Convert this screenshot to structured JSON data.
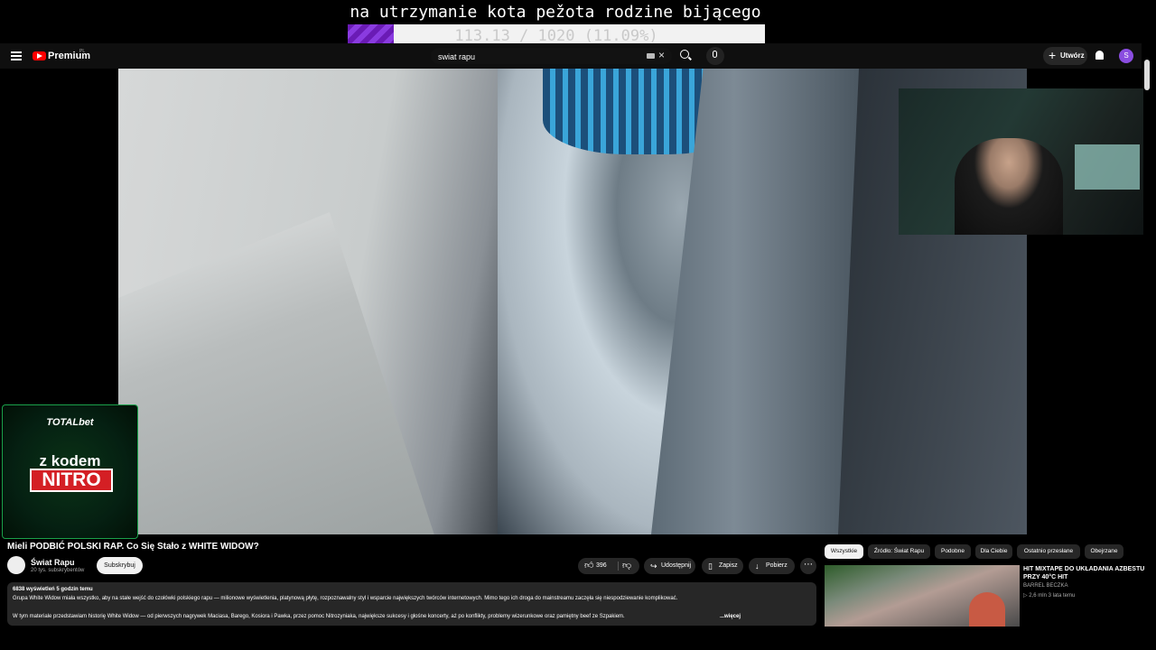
{
  "overlay": {
    "goal_title": "na utrzymanie kota pežota rodzine bijącego",
    "goal_text": "113.13 / 1020 (11.09%)",
    "goal_fraction": 0.1109,
    "accent": "#7a2bd0"
  },
  "topbar": {
    "brand": "Premium",
    "region": "PL",
    "search_value": "swiat rapu",
    "create_label": "Utwórz",
    "avatar_letter": "S"
  },
  "sponsor": {
    "logo": "TOTALbet",
    "code_text": "z kodem",
    "code": "NITRO"
  },
  "video": {
    "title": "Mieli PODBIĆ POLSKI RAP. Co Się Stało z WHITE WIDOW?",
    "channel": "Świat Rapu",
    "subscribers": "20 tys. subskrybentów",
    "subscribe_label": "Subskrybuj",
    "likes": "396",
    "share_label": "Udostępnij",
    "save_label": "Zapisz",
    "download_label": "Pobierz"
  },
  "description": {
    "stats": "6838 wyświetleń  5 godzin temu",
    "line1": "Grupa White Widow miała wszystko, aby na stałe wejść do czołówki polskiego rapu — milionowe wyświetlenia, platynową płytę, rozpoznawalny styl i wsparcie największych twórców internetowych. Mimo tego ich droga do mainstreamu zaczęła się niespodziewanie komplikować.",
    "line2": "W tym materiale przedstawiam historię White Widow — od pierwszych nagrywek Maciasa, Barego, Kosiora i Pawka, przez pomoc Nitrozyniaka, największe sukcesy i głośne koncerty, aż po konflikty, problemy wizerunkowe oraz pamiętny beef ze Szpakiem.",
    "more": "...więcej"
  },
  "chips": [
    "Wszystkie",
    "Źródło: Świat Rapu",
    "Podobne",
    "Dla Ciebie",
    "Ostatnio przesłane",
    "Obejrzane"
  ],
  "recommended": {
    "title": "HIT MIXTAPE DO UKŁADANIA AZBESTU PRZY 40°C HIT",
    "channel": "BARREL BECZKA",
    "meta": "▷ 2,6 mln  3 lata temu"
  }
}
